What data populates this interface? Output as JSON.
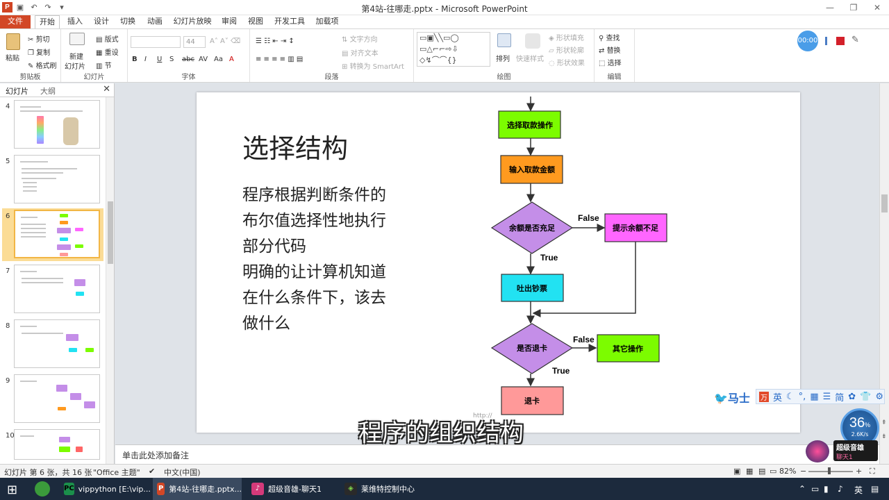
{
  "window": {
    "title": "第4站-往哪走.pptx - Microsoft PowerPoint",
    "app_logo": "P"
  },
  "ribbon_tabs": [
    "文件",
    "开始",
    "插入",
    "设计",
    "切换",
    "动画",
    "幻灯片放映",
    "审阅",
    "视图",
    "开发工具",
    "加载项"
  ],
  "ribbon": {
    "clipboard": {
      "paste": "粘贴",
      "cut": "剪切",
      "copy": "复制",
      "format_painter": "格式刷",
      "label": "剪贴板"
    },
    "slides": {
      "new_slide_1": "新建",
      "new_slide_2": "幻灯片",
      "layout": "版式",
      "reset": "重设",
      "section": "节",
      "label": "幻灯片"
    },
    "font": {
      "size": "44",
      "label": "字体"
    },
    "paragraph": {
      "text_direction": "文字方向",
      "align_text": "对齐文本",
      "smartart": "转换为 SmartArt",
      "label": "段落"
    },
    "drawing": {
      "arrange": "排列",
      "quick_styles": "快速样式",
      "shape_fill": "形状填充",
      "shape_outline": "形状轮廓",
      "shape_effects": "形状效果",
      "label": "绘图"
    },
    "editing": {
      "find": "查找",
      "replace": "替换",
      "select": "选择",
      "label": "编辑"
    }
  },
  "left_panel": {
    "tab_slides": "幻灯片",
    "tab_outline": "大纲",
    "slide_numbers": [
      "4",
      "5",
      "6",
      "7",
      "8",
      "9",
      "10"
    ]
  },
  "slide": {
    "title": "选择结构",
    "body_lines": [
      "程序根据判断条件的",
      "布尔值选择性地执行",
      "部分代码",
      "明确的让计算机知道",
      "在什么条件下，该去",
      "做什么"
    ],
    "flow": {
      "select_op": "选择取款操作",
      "input_amount": "输入取款金额",
      "balance_check": "余额是否充足",
      "insufficient": "提示余额不足",
      "dispense": "吐出钞票",
      "exit_card": "是否退卡",
      "other_op": "其它操作",
      "return_card": "退卡",
      "false_1": "False",
      "true_1": "True",
      "false_2": "False",
      "true_2": "True"
    },
    "watermark_url": "http://"
  },
  "notes_placeholder": "单击此处添加备注",
  "subtitle": "程序的组织结构",
  "status": {
    "slide_info": "幻灯片 第 6 张，共 16 张",
    "theme": "\"Office 主题\"",
    "language": "中文(中国)",
    "zoom": "82%"
  },
  "recorder": {
    "timer": "00:00"
  },
  "ime": {
    "brand": "马士",
    "mode": "英",
    "simp": "简"
  },
  "speed_widget": {
    "percent": "36",
    "unit": "%",
    "rate": "2.6K/s"
  },
  "music_widget": {
    "name": "超级音雄",
    "sub": "聊天1"
  },
  "taskbar": {
    "items": [
      "vippython [E:\\vip...",
      "第4站-往哪走.pptx...",
      "超级音雄-聊天1",
      "莱维特控制中心"
    ],
    "ime": "英"
  },
  "colors": {
    "file_tab": "#d24726",
    "green_box": "#7cfc00",
    "orange_box": "#ff9a1f",
    "purple_diamond": "#c48ee8",
    "magenta_box": "#ff66ff",
    "cyan_box": "#22e2f2",
    "pink_box": "#ff9999",
    "selected_thumb": "#f2b645"
  }
}
